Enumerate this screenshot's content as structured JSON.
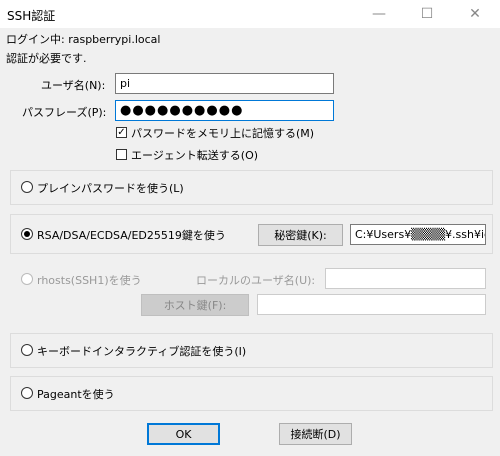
{
  "window": {
    "title": "SSH認証",
    "minimize_glyph": "—",
    "maximize_glyph": "☐",
    "close_glyph": "✕"
  },
  "login": {
    "line": "ログイン中: raspberrypi.local",
    "auth_required": "認証が必要です."
  },
  "form": {
    "username_label": "ユーザ名(N):",
    "username_value": "pi",
    "passphrase_label": "パスフレーズ(P):",
    "passphrase_mask": "●●●●●●●●●●",
    "remember_label": "パスワードをメモリ上に記憶する(M)",
    "remember_checked": true,
    "agent_forward_label": "エージェント転送する(O)",
    "agent_forward_checked": false
  },
  "options": {
    "plain_password_label": "プレインパスワードを使う(L)",
    "rsa_label": "RSA/DSA/ECDSA/ED25519鍵を使う",
    "rsa_selected": true,
    "private_key_button": "秘密鍵(K):",
    "private_key_path": "C:¥Users¥▒▒▒▒¥.ssh¥id_r",
    "rhosts_label": "rhosts(SSH1)を使う",
    "local_user_label": "ローカルのユーザ名(U):",
    "host_key_button": "ホスト鍵(F):",
    "keyboard_interactive_label": "キーボードインタラクティブ認証を使う(I)",
    "pageant_label": "Pageantを使う"
  },
  "buttons": {
    "ok": "OK",
    "disconnect": "接続断(D)"
  },
  "icons": {
    "check": "✓"
  }
}
